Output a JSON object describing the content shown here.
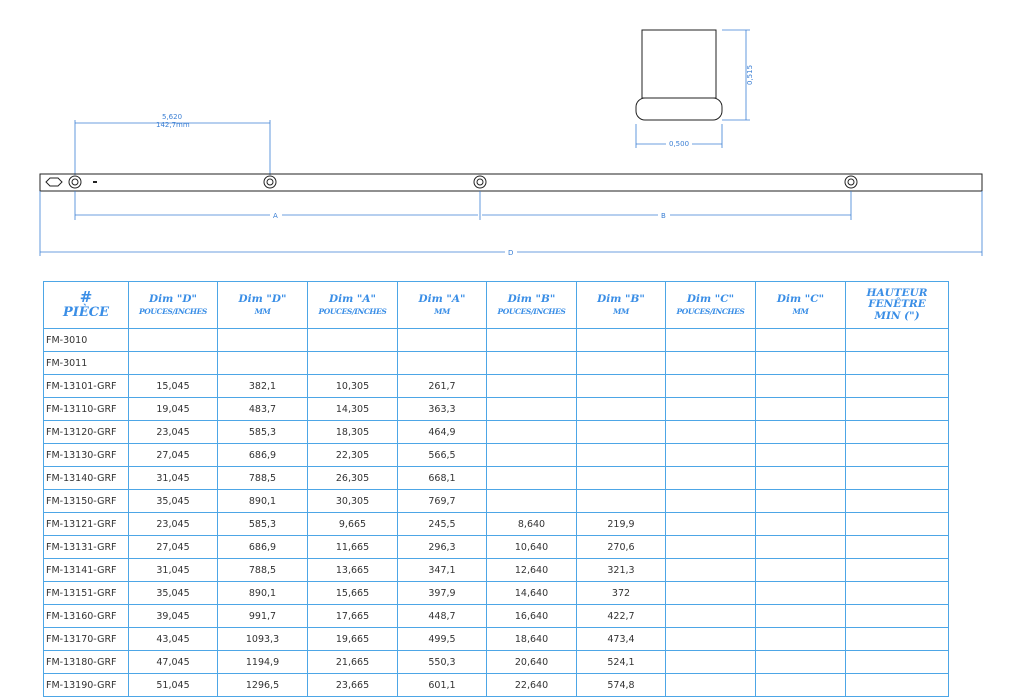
{
  "drawing": {
    "top_dim": {
      "inches": "5,620",
      "mm": "142,7mm"
    },
    "profile_dims": {
      "height": "0,515",
      "width": "0,500"
    },
    "bar_labels": {
      "a": "A",
      "b": "B",
      "d": "D"
    }
  },
  "table": {
    "headers": [
      {
        "line1": "#",
        "line2": "PIÈCE"
      },
      {
        "line1": "Dim \"D\"",
        "line2": "POUCES/INCHES"
      },
      {
        "line1": "Dim \"D\"",
        "line2": "MM"
      },
      {
        "line1": "Dim \"A\"",
        "line2": "POUCES/INCHES"
      },
      {
        "line1": "Dim \"A\"",
        "line2": "MM"
      },
      {
        "line1": "Dim \"B\"",
        "line2": "POUCES/INCHES"
      },
      {
        "line1": "Dim \"B\"",
        "line2": "MM"
      },
      {
        "line1": "Dim \"C\"",
        "line2": "POUCES/INCHES"
      },
      {
        "line1": "Dim \"C\"",
        "line2": "MM"
      },
      {
        "line1": "HAUTEUR FENÊTRE",
        "line2": "MIN (\")"
      }
    ],
    "rows": [
      [
        "FM-3010",
        "",
        "",
        "",
        "",
        "",
        "",
        "",
        "",
        ""
      ],
      [
        "FM-3011",
        "",
        "",
        "",
        "",
        "",
        "",
        "",
        "",
        ""
      ],
      [
        "FM-13101-GRF",
        "15,045",
        "382,1",
        "10,305",
        "261,7",
        "",
        "",
        "",
        "",
        ""
      ],
      [
        "FM-13110-GRF",
        "19,045",
        "483,7",
        "14,305",
        "363,3",
        "",
        "",
        "",
        "",
        ""
      ],
      [
        "FM-13120-GRF",
        "23,045",
        "585,3",
        "18,305",
        "464,9",
        "",
        "",
        "",
        "",
        ""
      ],
      [
        "FM-13130-GRF",
        "27,045",
        "686,9",
        "22,305",
        "566,5",
        "",
        "",
        "",
        "",
        ""
      ],
      [
        "FM-13140-GRF",
        "31,045",
        "788,5",
        "26,305",
        "668,1",
        "",
        "",
        "",
        "",
        ""
      ],
      [
        "FM-13150-GRF",
        "35,045",
        "890,1",
        "30,305",
        "769,7",
        "",
        "",
        "",
        "",
        ""
      ],
      [
        "FM-13121-GRF",
        "23,045",
        "585,3",
        "9,665",
        "245,5",
        "8,640",
        "219,9",
        "",
        "",
        ""
      ],
      [
        "FM-13131-GRF",
        "27,045",
        "686,9",
        "11,665",
        "296,3",
        "10,640",
        "270,6",
        "",
        "",
        ""
      ],
      [
        "FM-13141-GRF",
        "31,045",
        "788,5",
        "13,665",
        "347,1",
        "12,640",
        "321,3",
        "",
        "",
        ""
      ],
      [
        "FM-13151-GRF",
        "35,045",
        "890,1",
        "15,665",
        "397,9",
        "14,640",
        "372",
        "",
        "",
        ""
      ],
      [
        "FM-13160-GRF",
        "39,045",
        "991,7",
        "17,665",
        "448,7",
        "16,640",
        "422,7",
        "",
        "",
        ""
      ],
      [
        "FM-13170-GRF",
        "43,045",
        "1093,3",
        "19,665",
        "499,5",
        "18,640",
        "473,4",
        "",
        "",
        ""
      ],
      [
        "FM-13180-GRF",
        "47,045",
        "1194,9",
        "21,665",
        "550,3",
        "20,640",
        "524,1",
        "",
        "",
        ""
      ],
      [
        "FM-13190-GRF",
        "51,045",
        "1296,5",
        "23,665",
        "601,1",
        "22,640",
        "574,8",
        "",
        "",
        ""
      ]
    ]
  }
}
